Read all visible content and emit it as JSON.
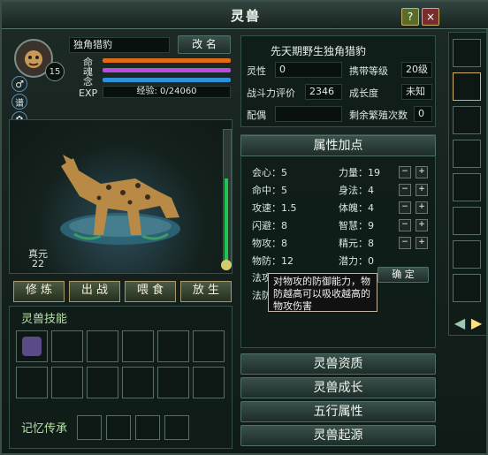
{
  "window": {
    "title": "灵兽",
    "help": "?",
    "close": "×"
  },
  "pet": {
    "name": "独角猎豹",
    "rename": "改 名",
    "level": "15",
    "exp_label": "EXP",
    "exp_text": "经验: 0/24060",
    "stats": [
      {
        "label": "命"
      },
      {
        "label": "魂"
      },
      {
        "label": "念"
      }
    ],
    "meta_label": "真元",
    "meta_value": "22",
    "left_buttons": [
      {
        "label": "♂"
      },
      {
        "label": "谱"
      },
      {
        "label": "✿"
      },
      {
        "label": "金"
      }
    ]
  },
  "summary": {
    "title": "先天期野生独角猎豹",
    "rows": [
      {
        "l": "灵性",
        "v": "0",
        "l2": "携带等级",
        "v2": "20级"
      },
      {
        "l": "战斗力评价",
        "v": "2346",
        "l2": "成长度",
        "v2": "未知"
      },
      {
        "l": "配偶",
        "v": "",
        "l2": "剩余繁殖次数",
        "v2": "0"
      }
    ]
  },
  "attrs": {
    "title": "属性加点",
    "rows": [
      {
        "a": "会心：5",
        "b": "力量：19"
      },
      {
        "a": "命中：5",
        "b": "身法：4"
      },
      {
        "a": "攻速：1.5",
        "b": "体魄：4"
      },
      {
        "a": "闪避：8",
        "b": "智慧：9"
      },
      {
        "a": "物攻：8",
        "b": "精元：8"
      },
      {
        "a": "物防：12",
        "b": "潜力：0"
      }
    ],
    "extra1": "法攻",
    "extra2": "法防",
    "confirm": "确 定"
  },
  "tooltip": "对物攻的防御能力，物防越高可以吸收越高的物攻伤害",
  "actions": [
    {
      "label": "修 炼"
    },
    {
      "label": "出 战"
    },
    {
      "label": "喂 食"
    },
    {
      "label": "放 生"
    }
  ],
  "skills": {
    "title": "灵兽技能",
    "memory": "记忆传承"
  },
  "sections": [
    {
      "label": "灵兽资质"
    },
    {
      "label": "灵兽成长"
    },
    {
      "label": "五行属性"
    },
    {
      "label": "灵兽起源"
    }
  ],
  "colors": {
    "accent": "#c8b16a",
    "bar1": "#e06a16",
    "bar2": "#b64ee0",
    "bar3": "#2e90d6"
  }
}
